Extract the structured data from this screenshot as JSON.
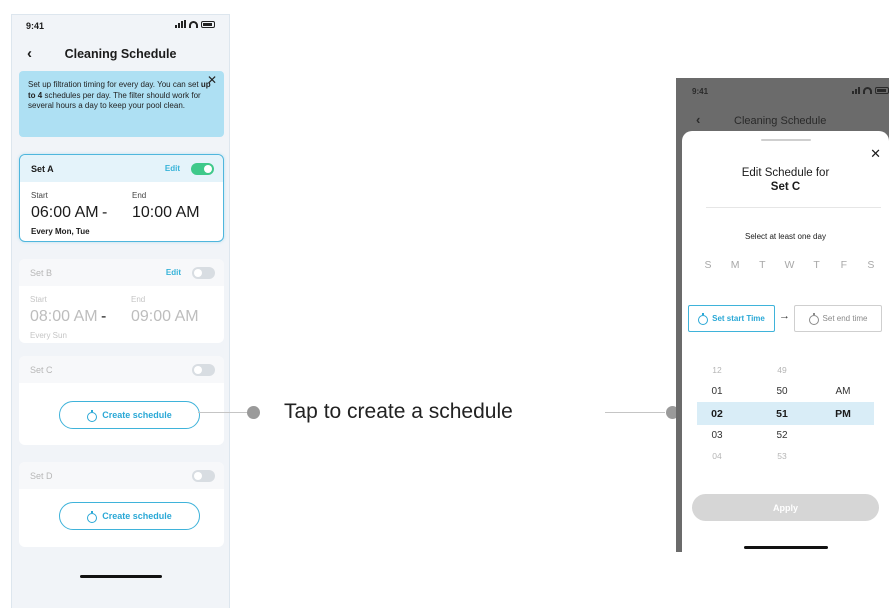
{
  "left_phone": {
    "status_time": "9:41",
    "nav": {
      "back": "‹",
      "title": "Cleaning Schedule"
    },
    "info": {
      "prefix": "Set up filtration timing for every day. You can set ",
      "bold": "up to 4",
      "suffix": " schedules per day. The filter should work for several hours a day to keep your pool clean.",
      "close": "✕"
    },
    "sets": [
      {
        "name": "Set A",
        "edit": "Edit",
        "enabled": true,
        "start_label": "Start",
        "end_label": "End",
        "start": "06:00 AM",
        "end": "10:00 AM",
        "dash": "-",
        "days": "Every Mon, Tue"
      },
      {
        "name": "Set B",
        "edit": "Edit",
        "enabled": false,
        "start_label": "Start",
        "end_label": "End",
        "start": "08:00 AM",
        "end": "09:00 AM",
        "dash": "-",
        "days": "Every Sun"
      },
      {
        "name": "Set C",
        "enabled": false,
        "button": "Create schedule"
      },
      {
        "name": "Set D",
        "enabled": false,
        "button": "Create schedule"
      }
    ]
  },
  "callout": {
    "text": "Tap to create a schedule"
  },
  "right_phone": {
    "status_time": "9:41",
    "nav": {
      "back": "‹",
      "title": "Cleaning Schedule"
    },
    "sheet": {
      "close": "✕",
      "title_line1": "Edit Schedule for",
      "title_line2": "Set C",
      "select_days": "Select at least one day",
      "days": [
        "S",
        "M",
        "T",
        "W",
        "T",
        "F",
        "S"
      ],
      "start_button": "Set start Time",
      "arrow": "→",
      "end_button": "Set end time",
      "picker": {
        "hours": [
          "12",
          "01",
          "02",
          "03",
          "04"
        ],
        "minutes": [
          "49",
          "50",
          "51",
          "52",
          "53"
        ],
        "ampm": [
          "AM",
          "PM"
        ],
        "selected": {
          "hour": "02",
          "minute": "51",
          "ampm": "PM"
        }
      },
      "apply": "Apply"
    }
  },
  "colors": {
    "accent": "#36b3d9",
    "toggle_on": "#3fc98a",
    "info_bg": "#aee0f3",
    "picker_highlight": "#d9edf7",
    "overlay": "#6b6b6b"
  }
}
